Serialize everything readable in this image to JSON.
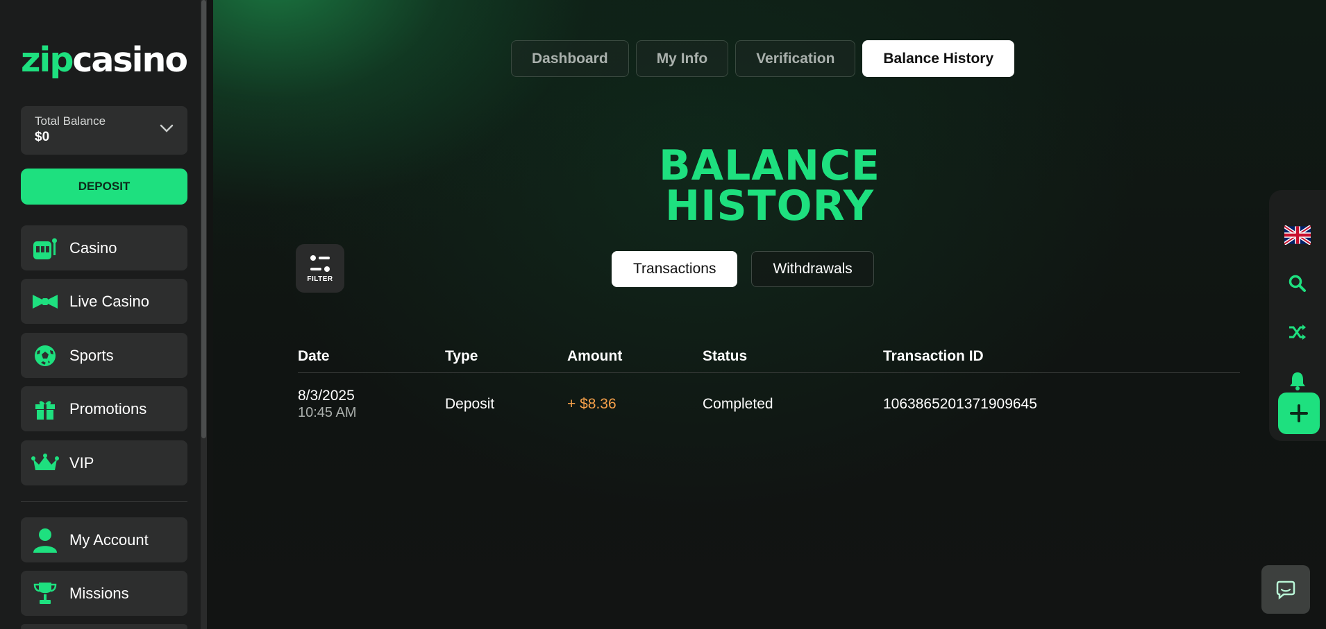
{
  "brand": {
    "logo_zip": "zip",
    "logo_casino": "casino",
    "accent_color": "#1ee07f"
  },
  "sidebar": {
    "balance_label": "Total Balance",
    "balance_value": "$0",
    "deposit_label": "DEPOSIT",
    "items": [
      {
        "label": "Casino",
        "icon": "slot-machine-icon"
      },
      {
        "label": "Live Casino",
        "icon": "bow-tie-icon"
      },
      {
        "label": "Sports",
        "icon": "soccer-ball-icon"
      },
      {
        "label": "Promotions",
        "icon": "gift-icon"
      },
      {
        "label": "VIP",
        "icon": "crown-icon"
      },
      {
        "label": "My Account",
        "icon": "user-icon"
      },
      {
        "label": "Missions",
        "icon": "trophy-icon"
      }
    ]
  },
  "top_tabs": [
    {
      "label": "Dashboard",
      "active": false
    },
    {
      "label": "My Info",
      "active": false
    },
    {
      "label": "Verification",
      "active": false
    },
    {
      "label": "Balance History",
      "active": true
    }
  ],
  "page": {
    "title_line1": "BALANCE",
    "title_line2": "HISTORY",
    "filter_label": "FILTER"
  },
  "sub_tabs": [
    {
      "label": "Transactions",
      "active": true
    },
    {
      "label": "Withdrawals",
      "active": false
    }
  ],
  "table": {
    "headers": [
      "Date",
      "Type",
      "Amount",
      "Status",
      "Transaction ID"
    ],
    "rows": [
      {
        "date": "8/3/2025",
        "time": "10:45 AM",
        "type": "Deposit",
        "amount": "+ $8.36",
        "status": "Completed",
        "transaction_id": "1063865201371909645"
      }
    ]
  },
  "right_rail": [
    "uk-flag-icon",
    "search-icon",
    "shuffle-icon",
    "bell-icon",
    "plus-icon"
  ],
  "chat": {
    "icon": "chat-bubble-icon"
  }
}
